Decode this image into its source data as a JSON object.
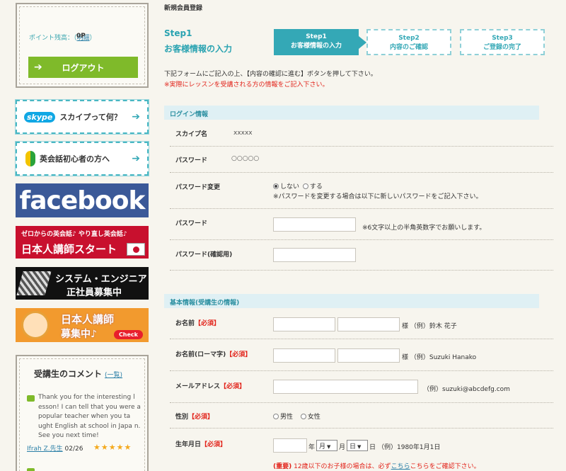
{
  "sidebar": {
    "points_label": "ポイント残高：",
    "points_value": "0P",
    "points_detail_link": "明細",
    "logout_label": "ログアウト",
    "skype_logo": "skype",
    "skype_label": "スカイプって何？",
    "beginner_label": "英会話初心者の方へ",
    "facebook_label": "facebook",
    "banner_start_top": "ゼロからの英会話♪ やり直し英会話♪",
    "banner_start_bottom": "日本人講師スタート",
    "banner_engineer_line1": "システム・エンジニア",
    "banner_engineer_line2": "正社員募集中",
    "banner_teacher_line1": "日本人講師",
    "banner_teacher_line2": "募集中♪",
    "banner_teacher_check": "Check",
    "comments_title": "受講生のコメント",
    "comments_list_link": "一覧",
    "comment_text": "Thank you for the interesting l esson! I can tell that you were a popular teacher when you ta ught English at school in Japa n. See you next time!",
    "comment_author": "Ifrah Z.先生",
    "comment_date": "02/26",
    "comment_stars": "★★★★★"
  },
  "main": {
    "breadcrumb": "新規会員登録",
    "step_title": "Step1",
    "step_subtitle": "お客様情報の入力",
    "steps": [
      {
        "num": "Step1",
        "label": "お客様情報の入力"
      },
      {
        "num": "Step2",
        "label": "内容のご確認"
      },
      {
        "num": "Step3",
        "label": "ご登録の完了"
      }
    ],
    "intro_text": "下記フォームにご記入の上、【内容の確認に進む】ボタンを押して下さい。",
    "intro_warning": "※実際にレッスンを受講される方の情報をご記入下さい。"
  },
  "login_section": {
    "title": "ログイン情報",
    "skype_name_label": "スカイプ名",
    "skype_name_value": "xxxxx",
    "password_label": "パスワード",
    "password_value": "○○○○○",
    "password_change_label": "パスワード変更",
    "change_no": "しない",
    "change_yes": "する",
    "change_note": "※パスワードを変更する場合は以下に新しいパスワードをご記入下さい。",
    "new_password_label": "パスワード",
    "new_password_note": "※6文字以上の半角英数字でお願いします。",
    "confirm_password_label": "パスワード(確認用)"
  },
  "basic_section": {
    "title": "基本情報(受講生の情報)",
    "required": "【必須】",
    "name_label": "お名前",
    "name_example": "様 （例）鈴木 花子",
    "roman_label": "お名前(ローマ字)",
    "roman_example": "様 （例）Suzuki Hanako",
    "email_label": "メールアドレス",
    "email_example": "（例）suzuki@abcdefg.com",
    "gender_label": "性別",
    "gender_male": "男性",
    "gender_female": "女性",
    "birth_label": "生年月日",
    "year_suffix": "年",
    "month_value": "月",
    "month_suffix": "月",
    "day_value": "日",
    "day_suffix": "日",
    "birth_example": "（例）1980年1月1日",
    "warning_important": "(重要)",
    "warning_text": "12歳以下のお子様の場合は、必ず",
    "warning_link": "こちら",
    "warning_tail": "こちらをご確認下さい。"
  },
  "colors": {
    "accent": "#34a8b6",
    "logout": "#7fba2a",
    "required": "#e2231a"
  }
}
